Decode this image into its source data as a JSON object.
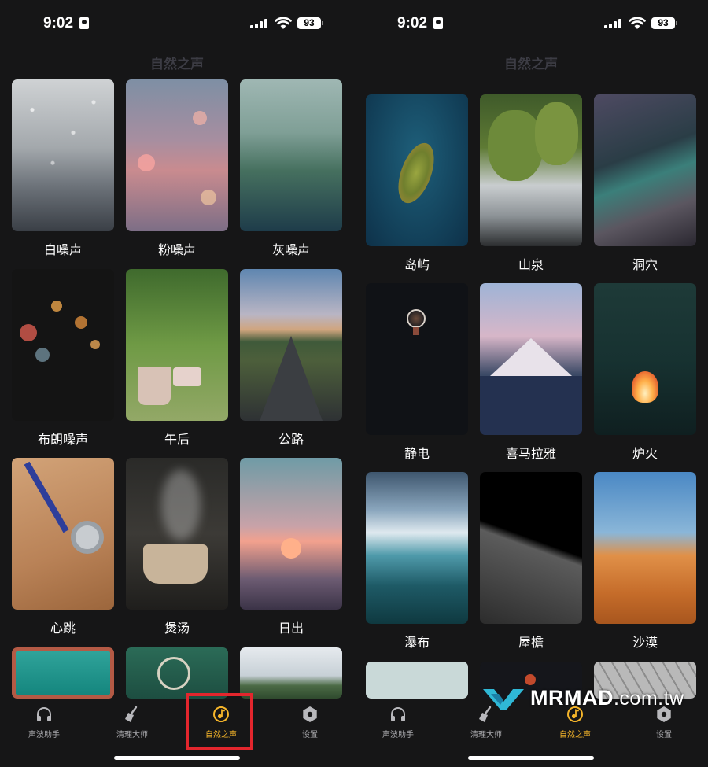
{
  "status_bar": {
    "time": "9:02",
    "battery": "93"
  },
  "page_title": "自然之声",
  "left_screen": {
    "tiles": [
      "白噪声",
      "粉噪声",
      "灰噪声",
      "布朗噪声",
      "午后",
      "公路",
      "心跳",
      "煲汤",
      "日出"
    ]
  },
  "right_screen": {
    "tiles": [
      "岛屿",
      "山泉",
      "洞穴",
      "静电",
      "喜马拉雅",
      "炉火",
      "瀑布",
      "屋檐",
      "沙漠"
    ]
  },
  "tabbar": {
    "tabs": [
      {
        "label": "声波助手",
        "icon": "headphones-icon"
      },
      {
        "label": "清理大师",
        "icon": "broom-icon"
      },
      {
        "label": "自然之声",
        "icon": "music-note-icon",
        "active": true
      },
      {
        "label": "设置",
        "icon": "gear-icon"
      }
    ]
  },
  "watermark": {
    "brand": "MRMAD",
    "domain": ".com.tw"
  },
  "colors": {
    "accent": "#f5b52a",
    "background": "#161617",
    "highlight_box": "#e3262d"
  }
}
